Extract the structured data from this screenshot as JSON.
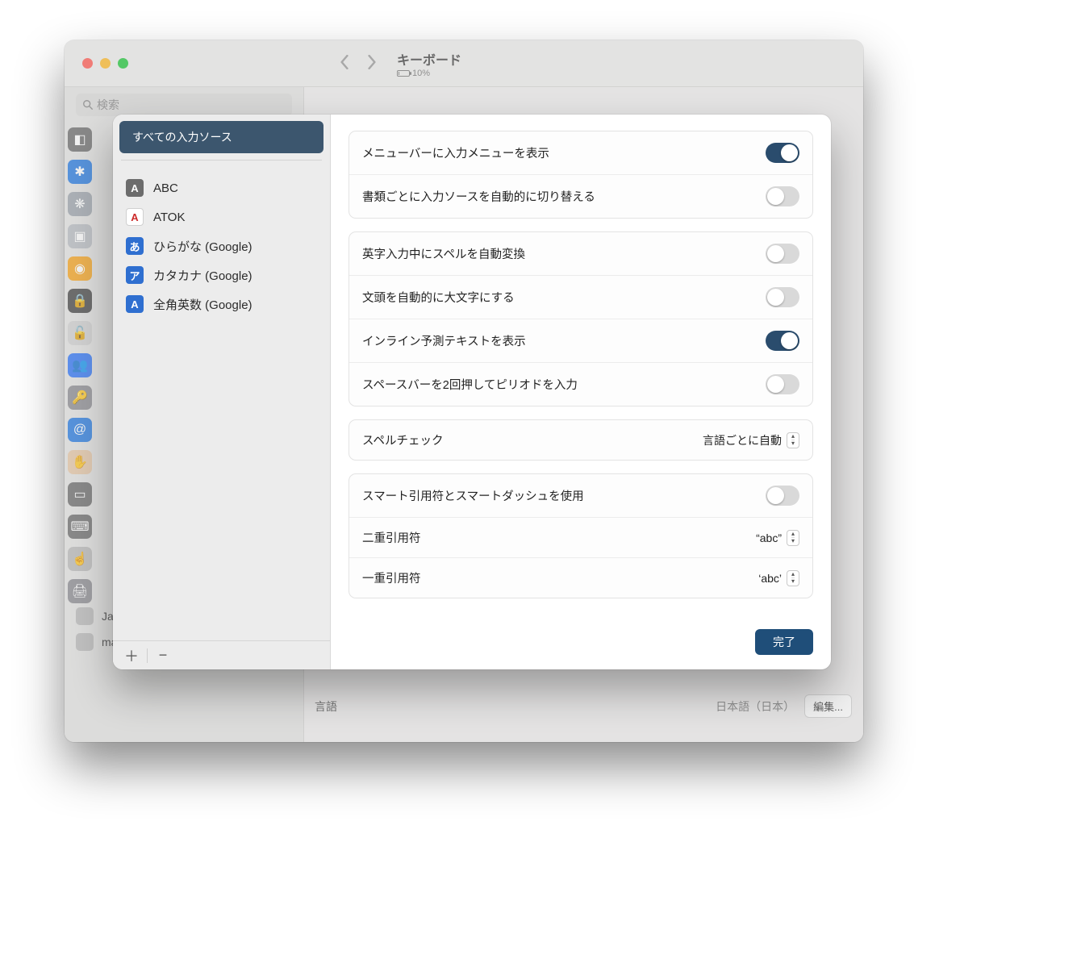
{
  "window": {
    "title": "キーボード",
    "battery_pct": "10%"
  },
  "bg_sidebar": {
    "search_placeholder": "検索",
    "items": [
      {
        "label": "Java"
      },
      {
        "label": "macFUSE"
      }
    ]
  },
  "bg_main": {
    "language_label": "言語",
    "language_value": "日本語（日本）",
    "edit_button": "編集..."
  },
  "sheet": {
    "header": "すべての入力ソース",
    "sources": [
      {
        "icon_text": "A",
        "icon_bg": "#6c6c6c",
        "label": "ABC"
      },
      {
        "icon_text": "A",
        "icon_bg": "#ffffff",
        "icon_fg": "#cc2a2a",
        "icon_border": "#d0d0d0",
        "label": "ATOK"
      },
      {
        "icon_text": "あ",
        "icon_bg": "#2f6fd0",
        "label": "ひらがな (Google)"
      },
      {
        "icon_text": "ア",
        "icon_bg": "#2f6fd0",
        "label": "カタカナ (Google)"
      },
      {
        "icon_text": "A",
        "icon_bg": "#2f6fd0",
        "label": "全角英数 (Google)"
      }
    ],
    "group1": [
      {
        "label": "メニューバーに入力メニューを表示",
        "on": true
      },
      {
        "label": "書類ごとに入力ソースを自動的に切り替える",
        "on": false
      }
    ],
    "group2": [
      {
        "label": "英字入力中にスペルを自動変換",
        "on": false
      },
      {
        "label": "文頭を自動的に大文字にする",
        "on": false
      },
      {
        "label": "インライン予測テキストを表示",
        "on": true
      },
      {
        "label": "スペースバーを2回押してピリオドを入力",
        "on": false
      }
    ],
    "group3": {
      "spellcheck_label": "スペルチェック",
      "spellcheck_value": "言語ごとに自動"
    },
    "group4": {
      "smartquotes": {
        "label": "スマート引用符とスマートダッシュを使用",
        "on": false
      },
      "double_quote": {
        "label": "二重引用符",
        "value": "“abc”"
      },
      "single_quote": {
        "label": "一重引用符",
        "value": "‘abc’"
      }
    },
    "done": "完了"
  }
}
